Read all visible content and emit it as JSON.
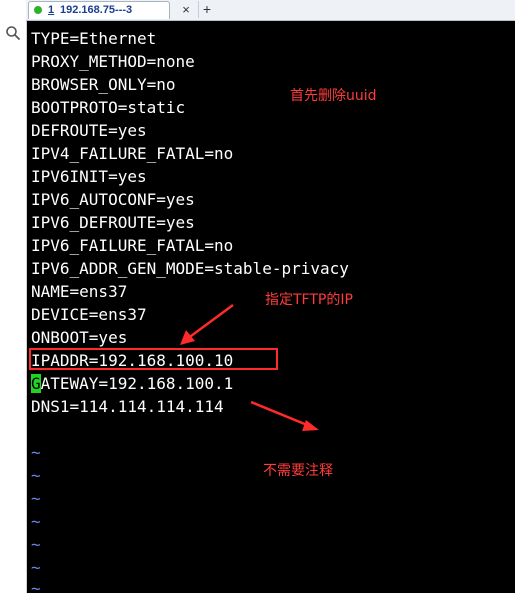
{
  "tab": {
    "number": "1",
    "title": "192.168.75---3",
    "close_glyph": "×",
    "add_glyph": "+",
    "status_color": "#2bb32b"
  },
  "side": {
    "search_icon": "search-icon"
  },
  "terminal": {
    "lines": [
      "TYPE=Ethernet",
      "PROXY_METHOD=none",
      "BROWSER_ONLY=no",
      "BOOTPROTO=static",
      "DEFROUTE=yes",
      "IPV4_FAILURE_FATAL=no",
      "IPV6INIT=yes",
      "IPV6_AUTOCONF=yes",
      "IPV6_DEFROUTE=yes",
      "IPV6_FAILURE_FATAL=no",
      "IPV6_ADDR_GEN_MODE=stable-privacy",
      "NAME=ens37",
      "DEVICE=ens37",
      "ONBOOT=yes",
      "IPADDR=192.168.100.10"
    ],
    "gateway_cursor_char": "G",
    "gateway_rest": "ATEWAY=192.168.100.1",
    "dns_line": "DNS1=114.114.114.114",
    "tilde": "~"
  },
  "annotations": {
    "delete_uuid": "首先删除uuid",
    "tftp_ip": "指定TFTP的IP",
    "no_comment": "不需要注释",
    "color": "#ff3b3b"
  }
}
